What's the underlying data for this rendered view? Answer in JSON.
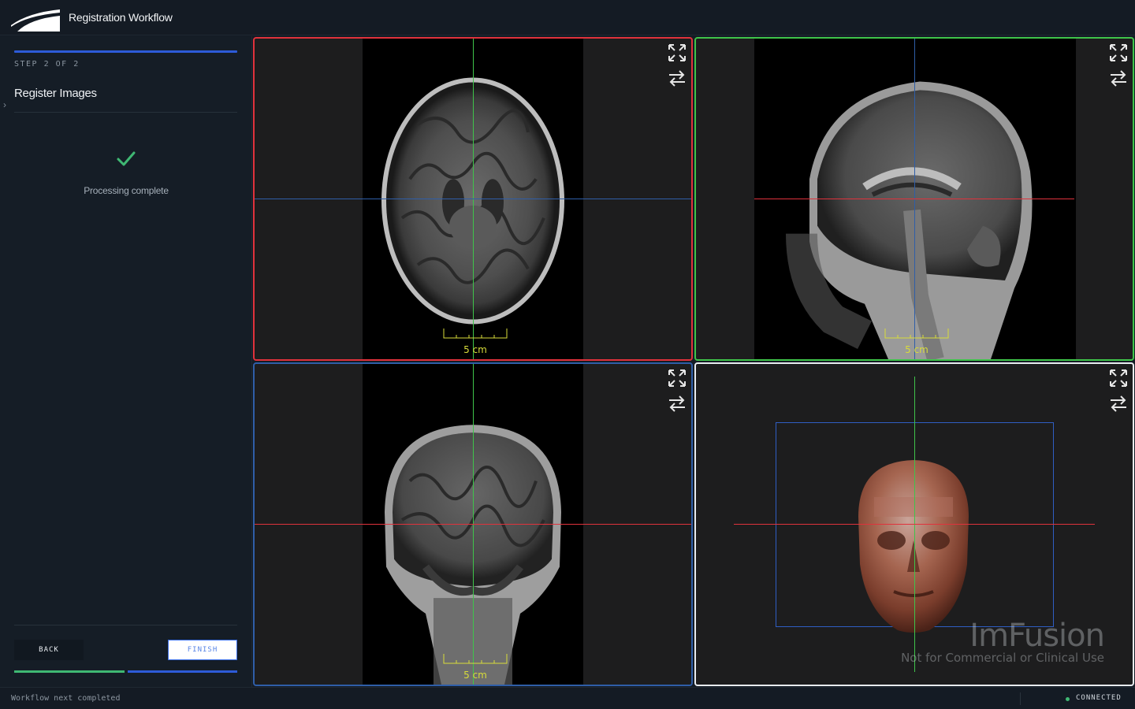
{
  "app": {
    "title": "Registration Workflow"
  },
  "sidebar": {
    "step_label": "STEP 2 OF 2",
    "step_title": "Register Images",
    "status_text": "Processing complete",
    "back_label": "BACK",
    "finish_label": "FINISH",
    "progress": 1.0
  },
  "viewports": [
    {
      "id": "axial",
      "border_color": "#e0323c",
      "scale_label": "5 cm"
    },
    {
      "id": "sagittal",
      "border_color": "#3fc44a",
      "scale_label": "5 cm"
    },
    {
      "id": "coronal",
      "border_color": "#2f5ea8",
      "scale_label": "5 cm"
    },
    {
      "id": "3d",
      "border_color": "#e8ecf0",
      "watermark_title": "ImFusion",
      "watermark_subtitle": "Not for Commercial or Clinical Use"
    }
  ],
  "statusbar": {
    "message": "Workflow next completed",
    "connection": "CONNECTED"
  },
  "colors": {
    "accent_blue": "#2d5bd8",
    "success_green": "#3fb873",
    "axial_red": "#e0323c",
    "sagittal_green": "#3fc44a",
    "coronal_blue": "#2f5ea8",
    "scale_yellow": "#d8dc3a"
  }
}
